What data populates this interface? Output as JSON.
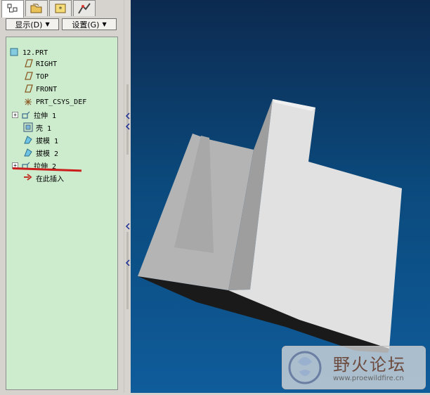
{
  "menus": [
    {
      "label": "显示(D)"
    },
    {
      "label": "设置(G)"
    }
  ],
  "tree": {
    "root": "12.PRT",
    "items": [
      {
        "label": "RIGHT",
        "icon": "datum-plane-icon",
        "expandable": false
      },
      {
        "label": "TOP",
        "icon": "datum-plane-icon",
        "expandable": false
      },
      {
        "label": "FRONT",
        "icon": "datum-plane-icon",
        "expandable": false
      },
      {
        "label": "PRT_CSYS_DEF",
        "icon": "coordinate-system-icon",
        "expandable": false
      },
      {
        "label": "拉伸 1",
        "icon": "extrude-icon",
        "expandable": true
      },
      {
        "label": "壳 1",
        "icon": "shell-icon",
        "expandable": false
      },
      {
        "label": "拔模 1",
        "icon": "draft-icon",
        "expandable": false
      },
      {
        "label": "拔模 2",
        "icon": "draft-icon",
        "expandable": false
      },
      {
        "label": "拉伸 2",
        "icon": "extrude-icon",
        "expandable": true
      },
      {
        "label": "在此插入",
        "icon": "insert-here-arrow-icon",
        "expandable": false
      }
    ]
  },
  "watermark": {
    "title": "野火论坛",
    "url": "www.proewildfire.cn"
  },
  "colors": {
    "tree_background": "#cdebcd",
    "viewport_top": "#0c2a50",
    "viewport_bottom": "#0f5c9b",
    "annotation_underline": "#cc1d1d"
  }
}
